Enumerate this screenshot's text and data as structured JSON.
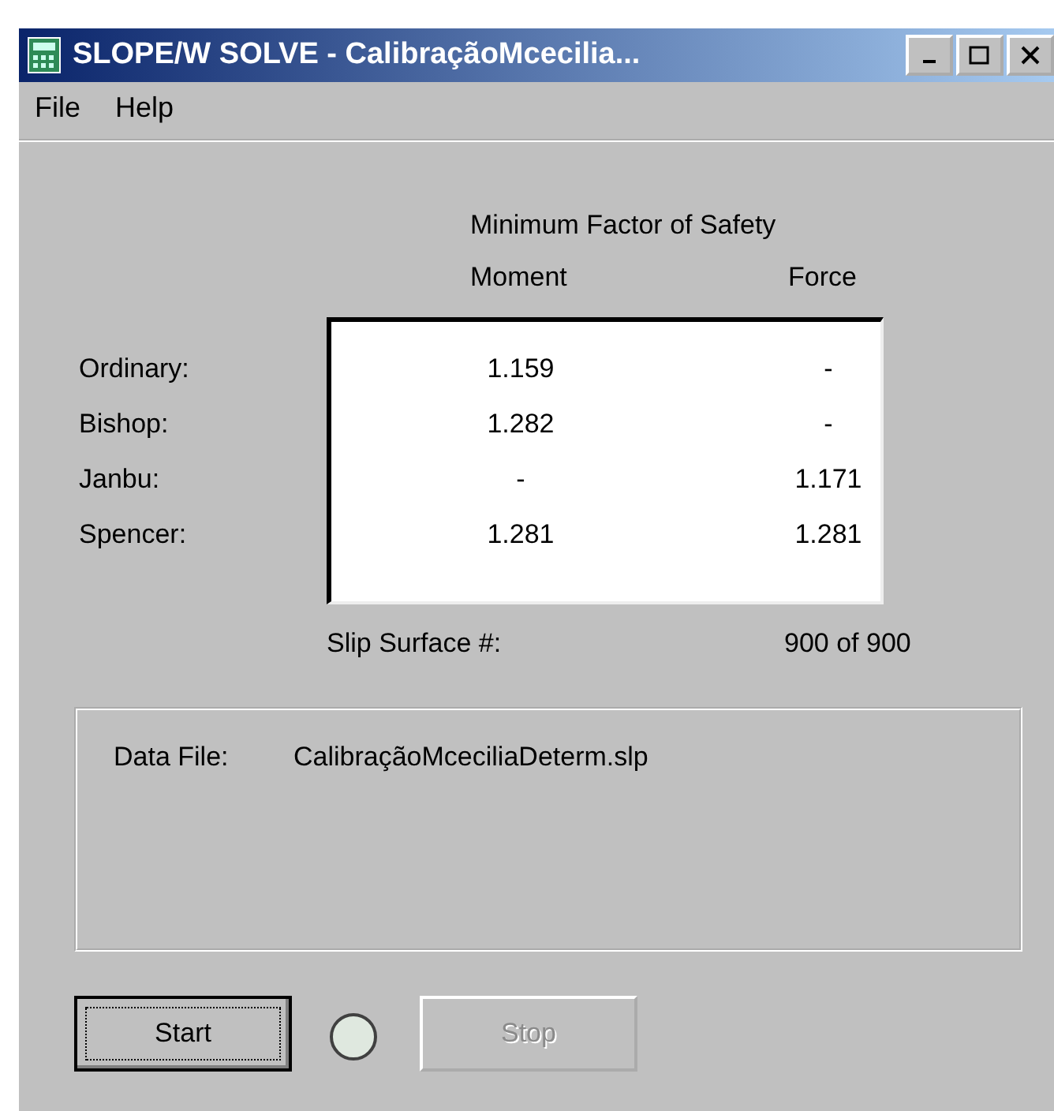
{
  "window": {
    "title": "SLOPE/W SOLVE - CalibraçãoMcecilia..."
  },
  "menu": [
    {
      "label": "File"
    },
    {
      "label": "Help"
    }
  ],
  "results": {
    "heading": "Minimum Factor of Safety",
    "columns": [
      "Moment",
      "Force"
    ],
    "rows": [
      {
        "method": "Ordinary:",
        "values": [
          "1.159",
          "-"
        ]
      },
      {
        "method": "Bishop:",
        "values": [
          "1.282",
          "-"
        ]
      },
      {
        "method": "Janbu:",
        "values": [
          "-",
          "1.171"
        ]
      },
      {
        "method": "Spencer:",
        "values": [
          "1.281",
          "1.281"
        ]
      }
    ],
    "slip_surface_label": "Slip Surface #:",
    "slip_surface_value": "900 of 900"
  },
  "data_file": {
    "label": "Data File:",
    "value": "CalibraçãoMceciliaDeterm.slp"
  },
  "buttons": [
    {
      "label": "Start",
      "focused": true,
      "disabled": false
    },
    {
      "label": "Stop",
      "focused": false,
      "disabled": true
    }
  ],
  "indicator": {
    "on": false
  }
}
